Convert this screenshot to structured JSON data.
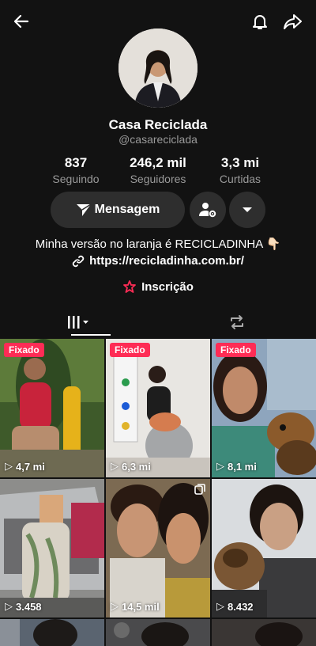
{
  "profile": {
    "name": "Casa Reciclada",
    "handle": "@casareciclada"
  },
  "stats": [
    {
      "value": "837",
      "label": "Seguindo"
    },
    {
      "value": "246,2 mil",
      "label": "Seguidores"
    },
    {
      "value": "3,3 mi",
      "label": "Curtidas"
    }
  ],
  "actions": {
    "message_label": "Mensagem"
  },
  "bio": {
    "text": "Minha versão no laranja é RECICLADINHA 👇🏻",
    "link": "https://recicladinha.com.br/",
    "subscription_label": "Inscrição"
  },
  "icons": [
    "back-icon",
    "bell-icon",
    "share-icon",
    "send-icon",
    "person-gear-icon",
    "chevron-down-icon",
    "link-icon",
    "subscription-icon",
    "grid-icon",
    "repost-icon",
    "play-icon",
    "multi-photo-icon"
  ],
  "colors": {
    "background": "#121212",
    "button": "#2e2e2e",
    "badge": "#fe2c55",
    "muted_text": "#9a9a9a"
  },
  "videos": [
    {
      "pinned": "Fixado",
      "views": "4,7 mi"
    },
    {
      "pinned": "Fixado",
      "views": "6,3 mi"
    },
    {
      "pinned": "Fixado",
      "views": "8,1 mi"
    },
    {
      "pinned": "",
      "views": "3.458"
    },
    {
      "pinned": "",
      "views": "14,5 mil"
    },
    {
      "pinned": "",
      "views": "8.432"
    }
  ]
}
